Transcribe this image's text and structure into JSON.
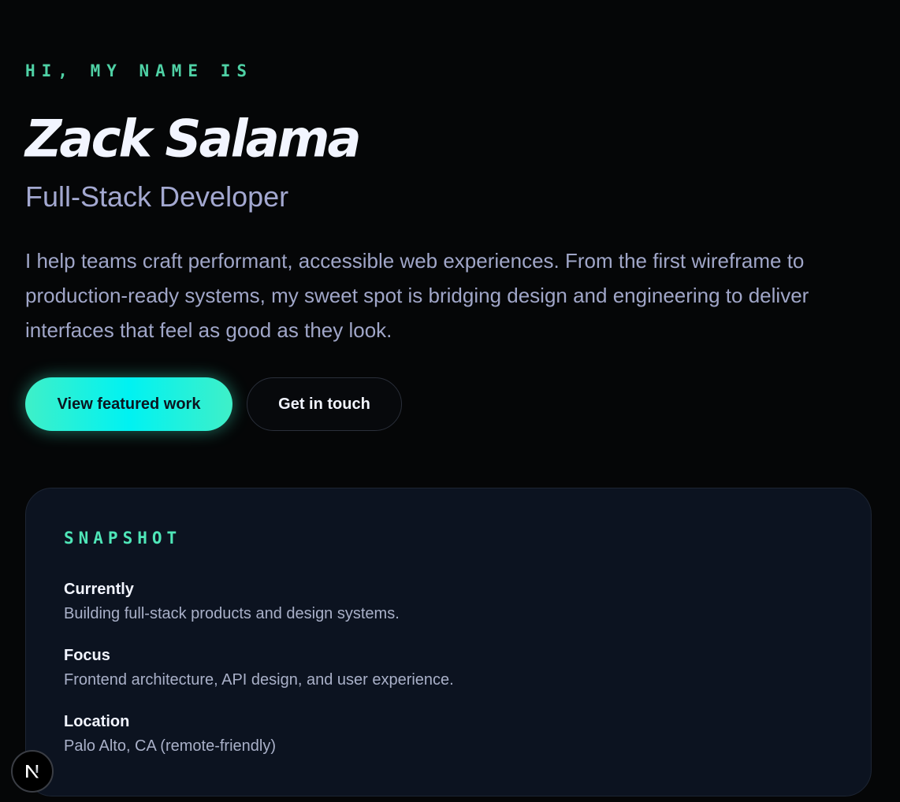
{
  "hero": {
    "eyebrow": "HI, MY NAME IS",
    "name": "Zack Salama",
    "role": "Full-Stack Developer",
    "bio": "I help teams craft performant, accessible web experiences. From the first wireframe to production-ready systems, my sweet spot is bridging design and engineering to deliver interfaces that feel as good as they look.",
    "primary_button": "View featured work",
    "secondary_button": "Get in touch"
  },
  "snapshot": {
    "title": "SNAPSHOT",
    "items": [
      {
        "label": "Currently",
        "value": "Building full-stack products and design systems."
      },
      {
        "label": "Focus",
        "value": "Frontend architecture, API design, and user experience."
      },
      {
        "label": "Location",
        "value": "Palo Alto, CA (remote-friendly)"
      }
    ]
  },
  "badge": {
    "icon": "nextjs-logo-icon"
  },
  "colors": {
    "accent": "#4fd1a5",
    "background": "#050607",
    "card": "#0c1320",
    "primary_gradient_start": "#3ff0c8",
    "primary_gradient_mid": "#00f2f2",
    "muted_text": "#a0a6c8"
  }
}
